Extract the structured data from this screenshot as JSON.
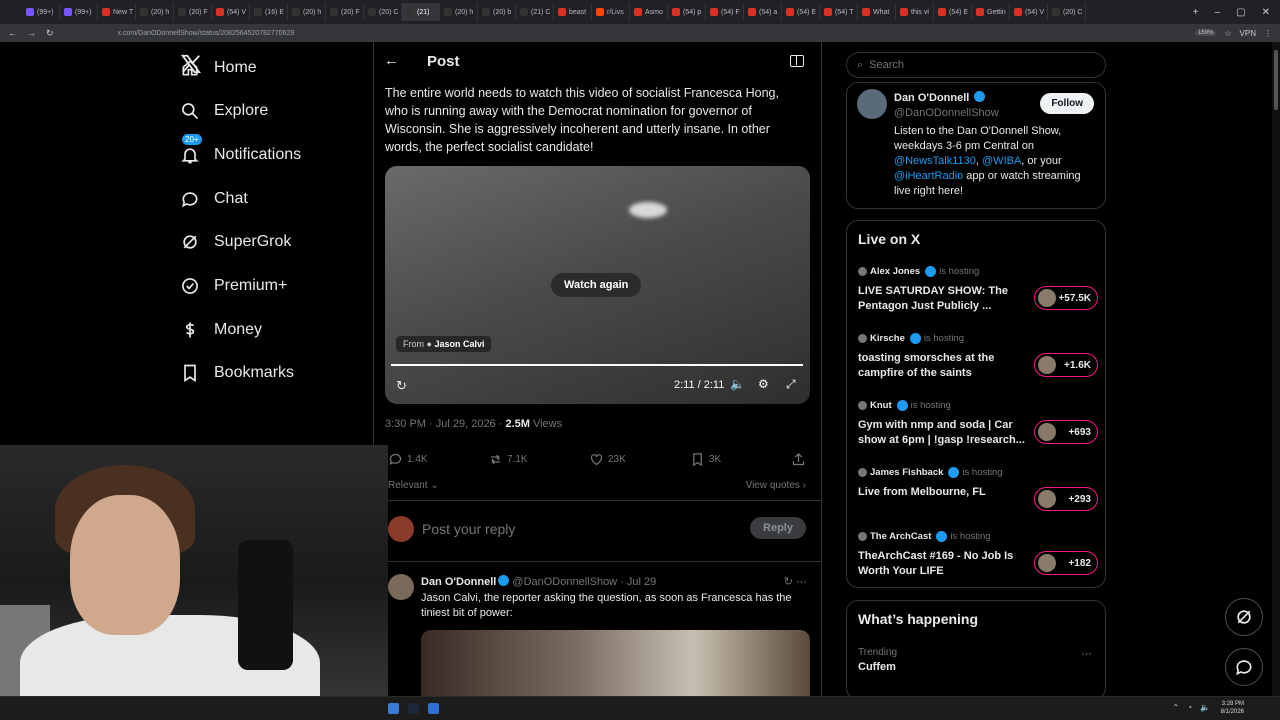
{
  "browser": {
    "tabs": [
      {
        "label": "(99+)",
        "color": "#7856ff"
      },
      {
        "label": "(99+)",
        "color": "#7856ff"
      },
      {
        "label": "New T",
        "color": "#d93025"
      },
      {
        "label": "(20) h",
        "color": "#333"
      },
      {
        "label": "(20) F",
        "color": "#333"
      },
      {
        "label": "(54) V",
        "color": "#d93025"
      },
      {
        "label": "(16) E",
        "color": "#333"
      },
      {
        "label": "(20) h",
        "color": "#333"
      },
      {
        "label": "(20) F",
        "color": "#333"
      },
      {
        "label": "(20) C",
        "color": "#333"
      },
      {
        "label": "(21)",
        "color": "#333"
      },
      {
        "label": "(20) h",
        "color": "#333"
      },
      {
        "label": "(20) b",
        "color": "#333"
      },
      {
        "label": "(21) C",
        "color": "#333"
      },
      {
        "label": "beast",
        "color": "#d93025"
      },
      {
        "label": "r/Livs",
        "color": "#ff4500"
      },
      {
        "label": "Asmo",
        "color": "#d93025"
      },
      {
        "label": "(54) p",
        "color": "#d93025"
      },
      {
        "label": "(54) F",
        "color": "#d93025"
      },
      {
        "label": "(54) a",
        "color": "#d93025"
      },
      {
        "label": "(54) E",
        "color": "#d93025"
      },
      {
        "label": "(54) T",
        "color": "#d93025"
      },
      {
        "label": "What",
        "color": "#d93025"
      },
      {
        "label": "this vi",
        "color": "#d93025"
      },
      {
        "label": "(54) E",
        "color": "#d93025"
      },
      {
        "label": "Gettin",
        "color": "#d93025"
      },
      {
        "label": "(54) V",
        "color": "#d93025"
      },
      {
        "label": "(20) C",
        "color": "#333"
      }
    ],
    "active_tab_index": 10,
    "url": "x.com/DanODonnellShow/status/2082564520782770629",
    "zoom": "150%",
    "vpn": "VPN"
  },
  "nav": {
    "items": [
      {
        "label": "Home",
        "icon": "home-icon"
      },
      {
        "label": "Explore",
        "icon": "search-icon"
      },
      {
        "label": "Notifications",
        "icon": "bell-icon",
        "badge": "20+"
      },
      {
        "label": "Chat",
        "icon": "chat-icon"
      },
      {
        "label": "SuperGrok",
        "icon": "grok-icon"
      },
      {
        "label": "Premium+",
        "icon": "verified-icon"
      },
      {
        "label": "Money",
        "icon": "dollar-icon"
      },
      {
        "label": "Bookmarks",
        "icon": "bookmark-icon"
      }
    ]
  },
  "post": {
    "header": "Post",
    "text": "The entire world needs to watch this video of socialist Francesca Hong, who is running away with the Democrat nomination for governor of Wisconsin. She is aggressively incoherent and utterly insane. In other words, the perfect socialist candidate!",
    "video": {
      "watch_again": "Watch again",
      "from_label": "From",
      "from_name": "Jason Calvi",
      "time": "2:11 / 2:11",
      "progress": 1.0
    },
    "timestamp": "3:30 PM · Jul 29, 2026 · ",
    "views_count": "2.5M",
    "views_label": " Views",
    "stats": {
      "replies": "1.4K",
      "reposts": "7.1K",
      "likes": "23K",
      "bookmarks": "3K"
    },
    "sort_label": "Relevant",
    "view_quotes": "View quotes",
    "reply_placeholder": "Post your reply",
    "reply_button": "Reply"
  },
  "reply": {
    "name": "Dan O'Donnell",
    "handle": "@DanODonnellShow",
    "date": "· Jul 29",
    "text": "Jason Calvi, the reporter asking the question, as soon as Francesca has the tiniest bit of power:"
  },
  "sidebar": {
    "search_placeholder": "Search",
    "profile": {
      "name": "Dan O'Donnell",
      "handle": "@DanODonnellShow",
      "follow": "Follow",
      "bio_1": "Listen to the Dan O'Donnell Show, weekdays 3-6 pm Central on ",
      "bio_link1": "@NewsTalk1130",
      "bio_2": ", ",
      "bio_link2": "@WIBA",
      "bio_3": ", or your ",
      "bio_link3": "@iHeartRadio",
      "bio_4": " app or watch streaming live right here!"
    },
    "live": {
      "title": "Live on X",
      "hosting_label": "is hosting",
      "items": [
        {
          "host": "Alex Jones",
          "title": "LIVE SATURDAY SHOW: The Pentagon Just Publicly ...",
          "count": "+57.5K"
        },
        {
          "host": "Kirsche",
          "title": "toasting smorsches at the campfire of the saints",
          "count": "+1.6K"
        },
        {
          "host": "Knut",
          "title": "Gym with nmp and soda | Car show at 6pm | !gasp !research...",
          "count": "+693"
        },
        {
          "host": "James Fishback",
          "title": "Live from Melbourne, FL",
          "count": "+293"
        },
        {
          "host": "The ArchCast",
          "title": "TheArchCast #169 - No Job Is Worth Your LIFE",
          "count": "+182"
        }
      ]
    },
    "happening": {
      "title": "What’s happening",
      "trend_label": "Trending",
      "trend_name": "Cuffem"
    }
  },
  "taskbar": {
    "time": "3:28 PM",
    "date": "8/1/2026"
  },
  "colors": {
    "accent": "#1d9bf0",
    "live": "#f91880",
    "bg": "#000000",
    "border": "#2f3336"
  }
}
